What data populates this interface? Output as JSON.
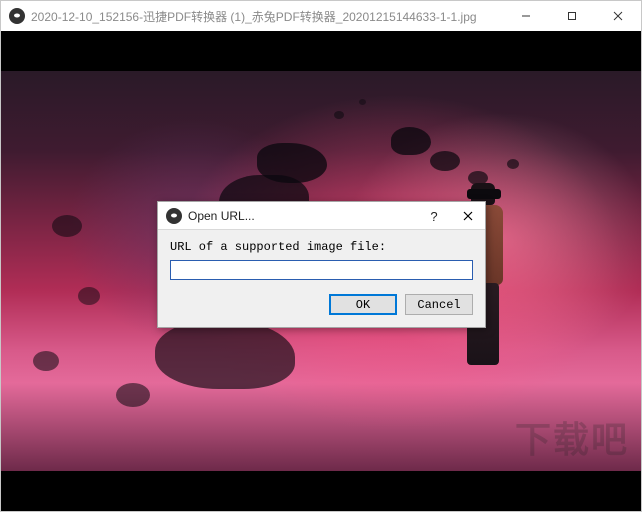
{
  "window": {
    "title": "2020-12-10_152156-迅捷PDF转换器 (1)_赤兔PDF转换器_20201215144633-1-1.jpg",
    "controls": {
      "minimize": "–",
      "maximize": "□",
      "close": "×"
    }
  },
  "dialog": {
    "title": "Open URL...",
    "help": "?",
    "close": "×",
    "label": "URL of a supported image file:",
    "input_value": "",
    "ok": "OK",
    "cancel": "Cancel"
  },
  "watermark": "下载吧"
}
